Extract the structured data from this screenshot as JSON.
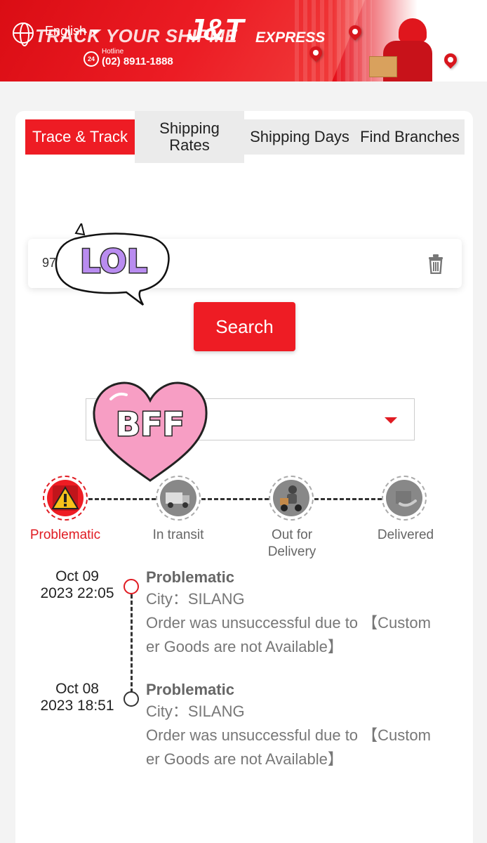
{
  "header": {
    "background_title": "TRACK YOUR SHIPME",
    "language": "English",
    "brand": "J&T",
    "brand_sub": "EXPRESS",
    "hotline_label": "Hotline",
    "hotline_badge": "24",
    "hotline_number": "(02) 8911-1888",
    "brand_color": "#e50914"
  },
  "tabs": [
    {
      "label": "Trace & Track",
      "active": true
    },
    {
      "label": "Shipping Rates",
      "active": false
    },
    {
      "label": "Shipping Days",
      "active": false
    },
    {
      "label": "Find Branches",
      "active": false
    }
  ],
  "search": {
    "value": "97",
    "button_label": "Search"
  },
  "stickers": {
    "top": "LOL",
    "bottom": "BFF"
  },
  "progress": [
    {
      "label": "Problematic",
      "icon": "warning-icon",
      "active": true
    },
    {
      "label": "In transit",
      "icon": "truck-icon",
      "active": false
    },
    {
      "label": "Out for Delivery",
      "icon": "scooter-icon",
      "active": false
    },
    {
      "label": "Delivered",
      "icon": "parcel-icon",
      "active": false
    }
  ],
  "timeline": [
    {
      "date": "Oct 09",
      "time": "2023 22:05",
      "status": "Problematic",
      "city": "City：SILANG",
      "detail_line1": "Order was unsuccessful due to 【Custom",
      "detail_line2": "er Goods are not Available】"
    },
    {
      "date": "Oct 08",
      "time": "2023 18:51",
      "status": "Problematic",
      "city": "City：SILANG",
      "detail_line1": "Order was unsuccessful due to 【Custom",
      "detail_line2": "er Goods are not Available】"
    }
  ],
  "accent_color": "#ee1c24"
}
